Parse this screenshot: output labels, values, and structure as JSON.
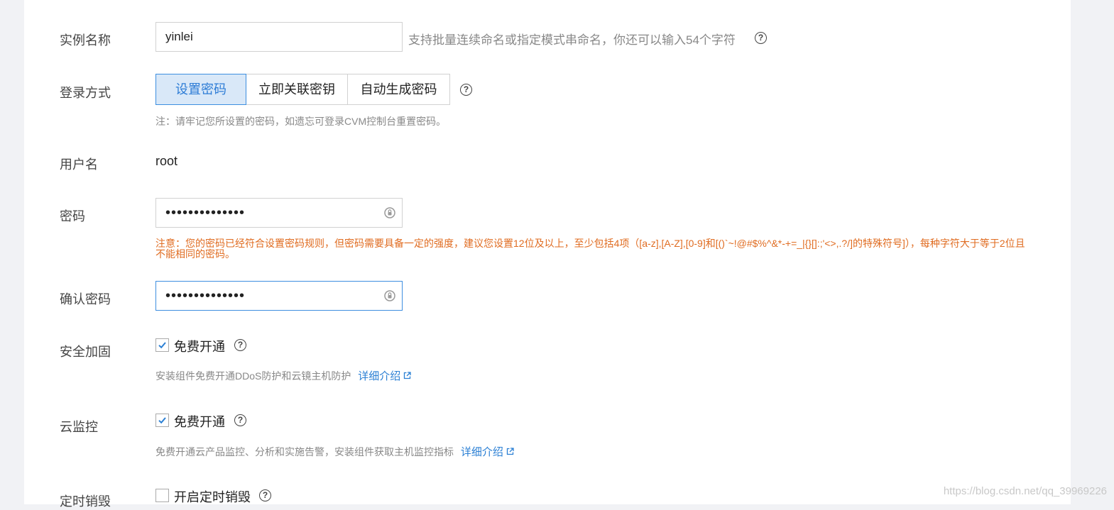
{
  "form": {
    "instance_name": {
      "label": "实例名称",
      "value": "yinlei",
      "hint": "支持批量连续命名或指定模式串命名，你还可以输入54个字符"
    },
    "login_method": {
      "label": "登录方式",
      "tabs": [
        "设置密码",
        "立即关联密钥",
        "自动生成密码"
      ],
      "active_tab": "设置密码",
      "note": "注：请牢记您所设置的密码，如遗忘可登录CVM控制台重置密码。"
    },
    "username": {
      "label": "用户名",
      "value": "root"
    },
    "password": {
      "label": "密码",
      "value": "••••••••••••••",
      "warning": "注意：您的密码已经符合设置密码规则，但密码需要具备一定的强度，建议您设置12位及以上，至少包括4项（[a-z],[A-Z],[0-9]和[()`~!@#$%^&*-+=_|{}[]:;'<>,.?/]的特殊符号]），每种字符大于等于2位且不能相同的密码。"
    },
    "confirm_password": {
      "label": "确认密码",
      "value": "••••••••••••••"
    },
    "security": {
      "label": "安全加固",
      "checkbox_label": "免费开通",
      "checked": true,
      "desc": "安装组件免费开通DDoS防护和云镜主机防护",
      "link": "详细介绍"
    },
    "monitoring": {
      "label": "云监控",
      "checkbox_label": "免费开通",
      "checked": true,
      "desc": "免费开通云产品监控、分析和实施告警，安装组件获取主机监控指标",
      "link": "详细介绍"
    },
    "scheduled_destroy": {
      "label": "定时销毁",
      "checkbox_label": "开启定时销毁",
      "checked": false
    }
  },
  "watermark": "https://blog.csdn.net/qq_39969226",
  "colors": {
    "accent": "#2d7cd6",
    "warning": "#e06c21"
  }
}
